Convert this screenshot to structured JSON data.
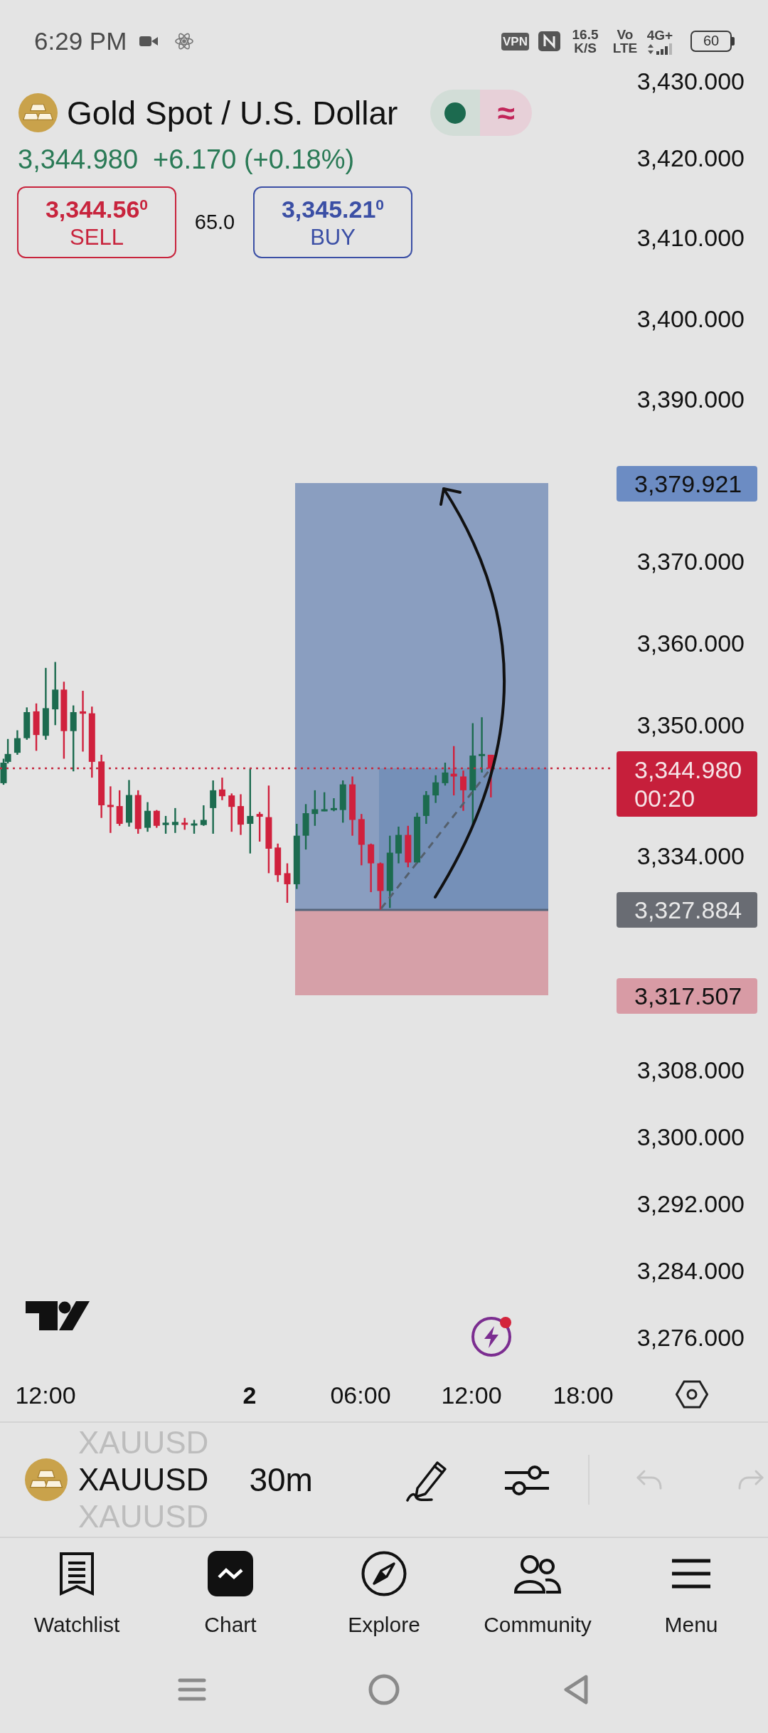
{
  "status_bar": {
    "time": "6:29 PM",
    "vpn": "VPN",
    "network_speed": "16.5 K/S",
    "volte": "Vo LTE",
    "network_type": "4G+",
    "battery": "60"
  },
  "header": {
    "title": "Gold Spot / U.S. Dollar",
    "delay_mark": "≈",
    "last_price": "3,344.980",
    "change": "+6.170 (+0.18%)",
    "sell": {
      "price": "3,344.56$^{0}$",
      "label": "SELL"
    },
    "spread": "65.0",
    "buy": {
      "price": "3,345.21$^{0}$",
      "label": "BUY"
    }
  },
  "price_axis": {
    "labels": [
      "3,430.000",
      "3,420.000",
      "3,410.000",
      "3,400.000",
      "3,390.000",
      "3,370.000",
      "3,360.000",
      "3,350.000",
      "3,334.000",
      "3,308.000",
      "3,300.000",
      "3,292.000",
      "3,284.000",
      "3,276.000"
    ]
  },
  "price_tags": [
    {
      "kind": "target",
      "price": "3,379.921"
    },
    {
      "kind": "last",
      "price": "3,344.980",
      "countdown": "00:20"
    },
    {
      "kind": "entry",
      "price": "3,327.884"
    },
    {
      "kind": "stop",
      "price": "3,317.507"
    }
  ],
  "time_axis": {
    "labels": [
      {
        "kind": "time",
        "text": "12:00"
      },
      {
        "kind": "day",
        "text": "2"
      },
      {
        "kind": "time",
        "text": "06:00"
      },
      {
        "kind": "time",
        "text": "12:00"
      },
      {
        "kind": "time",
        "text": "18:00"
      }
    ]
  },
  "toolbar": {
    "symbols": [
      {
        "label": "XAUUSD",
        "selected": false
      },
      {
        "label": "XAUUSD",
        "selected": true
      },
      {
        "label": "XAUUSD",
        "selected": false
      }
    ],
    "interval": "30m",
    "undo": {
      "disabled": true
    },
    "redo": {
      "disabled": true
    }
  },
  "bottom_nav": [
    {
      "label": "Watchlist",
      "selected": false
    },
    {
      "label": "Chart",
      "selected": true
    },
    {
      "label": "Explore",
      "selected": false
    },
    {
      "label": "Community",
      "selected": false
    },
    {
      "label": "Menu",
      "selected": false
    }
  ]
}
